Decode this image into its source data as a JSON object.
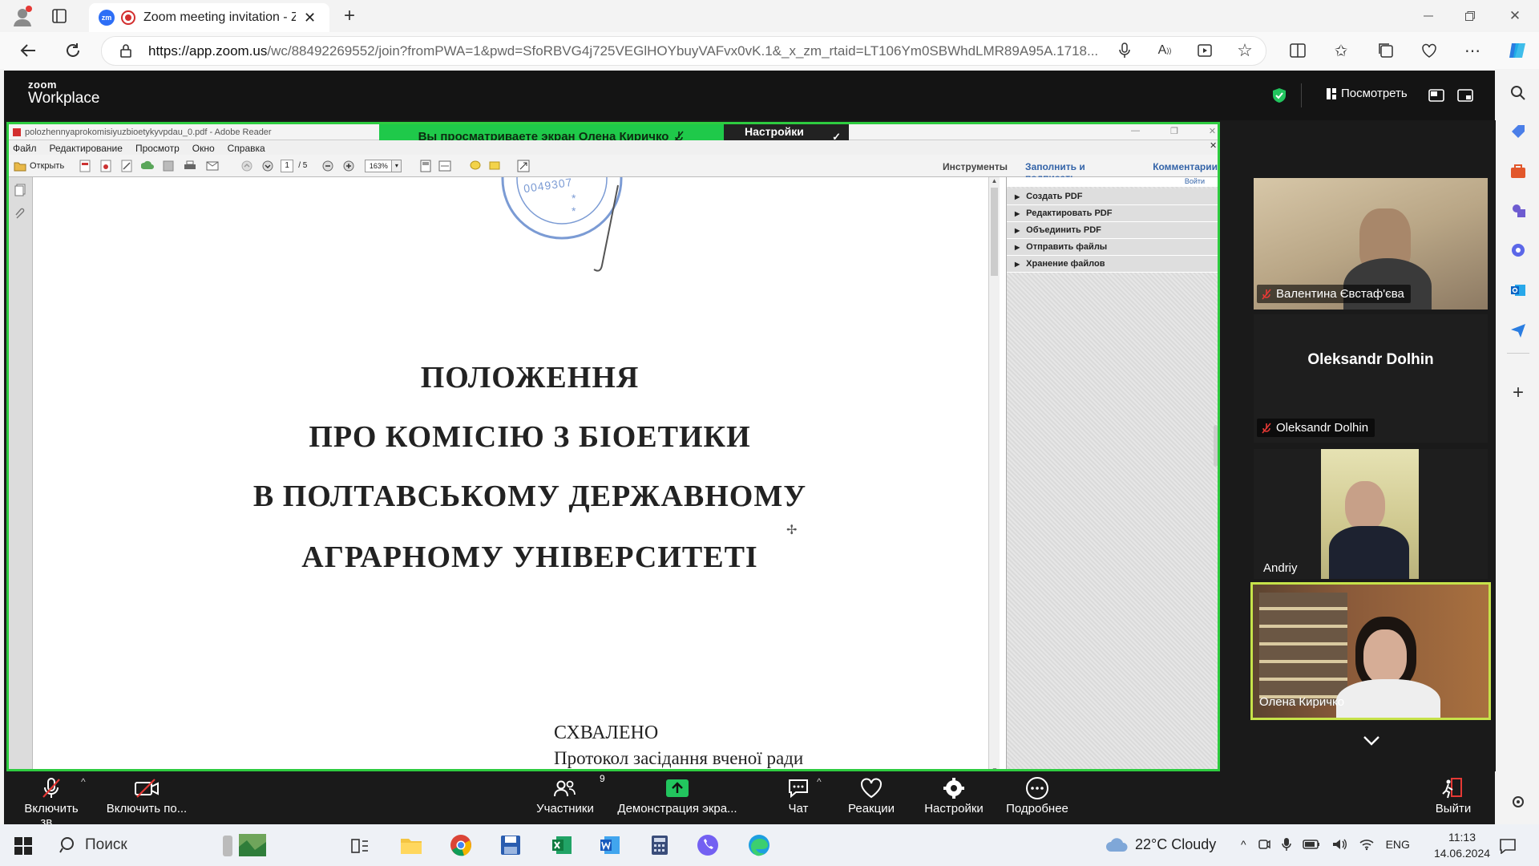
{
  "browser": {
    "tab_title": "Zoom meeting invitation - Z",
    "url_host": "https://app.zoom.us",
    "url_rest": "/wc/88492269552/join?fromPWA=1&pwd=SfoRBVG4j725VEGlHOYbuyVAFvx0vK.1&_x_zm_rtaid=LT106Ym0SBWhdLMR89A95A.1718...",
    "tab_badge": "zm"
  },
  "zoom": {
    "logo_top": "zoom",
    "logo_bottom": "Workplace",
    "view_label": "Посмотреть",
    "share_banner": "Вы просматриваете экран  Олена Киричко",
    "view_settings": "Настройки просмотра"
  },
  "pdf": {
    "window_title": "polozhennyaprokomisiyuzbioetykyvpdau_0.pdf - Adobe Reader",
    "menu": [
      "Файл",
      "Редактирование",
      "Просмотр",
      "Окно",
      "Справка"
    ],
    "open_label": "Открыть",
    "page_current": "1",
    "page_total": "/ 5",
    "zoom_value": "163%",
    "tools": [
      "Инструменты",
      "Заполнить и подписать",
      "Комментарии"
    ],
    "signin": "Войти",
    "panel_items": [
      "Создать PDF",
      "Редактировать PDF",
      "Объединить PDF",
      "Отправить файлы",
      "Хранение файлов"
    ],
    "stamp_digits": "0049307",
    "heading": [
      "ПОЛОЖЕННЯ",
      "ПРО КОМІСІЮ З БІОЕТИКИ",
      "В ПОЛТАВСЬКОМУ ДЕРЖАВНОМУ",
      "АГРАРНОМУ УНІВЕРСИТЕТІ"
    ],
    "approved": "СХВАЛЕНО",
    "protocol": "Протокол засідання вченої ради"
  },
  "participants": [
    {
      "name": "Валентина Євстаф'єва",
      "muted": true
    },
    {
      "name": "Oleksandr Dolhin",
      "muted": true,
      "big_name": "Oleksandr Dolhin"
    },
    {
      "name": "Andriy",
      "muted": false
    },
    {
      "name": "Олена Киричко",
      "muted": false
    }
  ],
  "bottom": {
    "audio": "Включить зв...",
    "video": "Включить по...",
    "participants": "Участники",
    "participants_count": "9",
    "share": "Демонстрация экра...",
    "chat": "Чат",
    "reactions": "Реакции",
    "settings": "Настройки",
    "more": "Подробнее",
    "leave": "Выйти"
  },
  "taskbar": {
    "search": "Поиск",
    "weather": "22°C  Cloudy",
    "lang": "ENG",
    "time": "11:13",
    "date": "14.06.2024"
  },
  "colors": {
    "zoom_bg": "#1a1a1a",
    "share_green": "#2ecc40",
    "active_speaker": "#c6e24a"
  }
}
